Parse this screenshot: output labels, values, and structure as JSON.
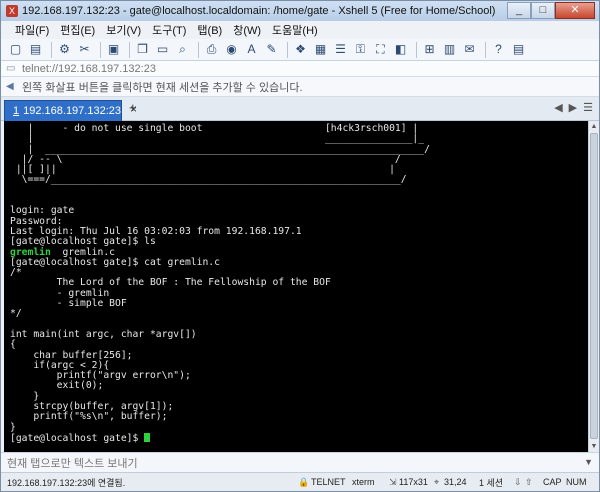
{
  "window": {
    "title": "192.168.197.132:23 - gate@localhost.localdomain: /home/gate - Xshell 5 (Free for Home/School)",
    "buttons": [
      "_",
      "□",
      "✕"
    ]
  },
  "menu": [
    "파일(F)",
    "편집(E)",
    "보기(V)",
    "도구(T)",
    "탭(B)",
    "창(W)",
    "도움말(H)"
  ],
  "address_bar": "telnet://192.168.197.132:23",
  "hint_bar": "왼쪽 화살표 버튼을 클릭하면 현재 세션을 추가할 수 있습니다.",
  "tabs": [
    {
      "num": "1",
      "label": "192.168.197.132:23"
    }
  ],
  "terminal": {
    "banner": [
      "   |     - do not use single boot                     [h4ck3rsch001] |",
      "   |                                                  _______________|_",
      "   |  _________________________________________________________________/",
      "  |/ -- \\                                                         /",
      " ||[ ]||                                                         |",
      "  \\===/____________________________________________________________/"
    ],
    "lines": [
      "",
      "",
      "login: gate",
      "Password:",
      "Last login: Thu Jul 16 03:02:03 from 192.168.197.1",
      "[gate@localhost gate]$ ls"
    ],
    "ls_output_green": "gremlin",
    "ls_output_rest": "  gremlin.c",
    "code_lines": [
      "[gate@localhost gate]$ cat gremlin.c",
      "/*",
      "        The Lord of the BOF : The Fellowship of the BOF",
      "        - gremlin",
      "        - simple BOF",
      "*/",
      "",
      "int main(int argc, char *argv[])",
      "{",
      "    char buffer[256];",
      "    if(argc < 2){",
      "        printf(\"argv error\\n\");",
      "        exit(0);",
      "    }",
      "    strcpy(buffer, argv[1]);",
      "    printf(\"%s\\n\", buffer);",
      "}"
    ],
    "prompt": "[gate@localhost gate]$ "
  },
  "send_bar": "현재 탭으로만 텍스트 보내기",
  "status": {
    "host": "192.168.197.132:23에 연결됨.",
    "protocol": "TELNET",
    "terminal": "xterm",
    "size": "117x31",
    "cursor": "31,24",
    "sessions": "1 세션",
    "cap": "CAP",
    "num": "NUM"
  }
}
